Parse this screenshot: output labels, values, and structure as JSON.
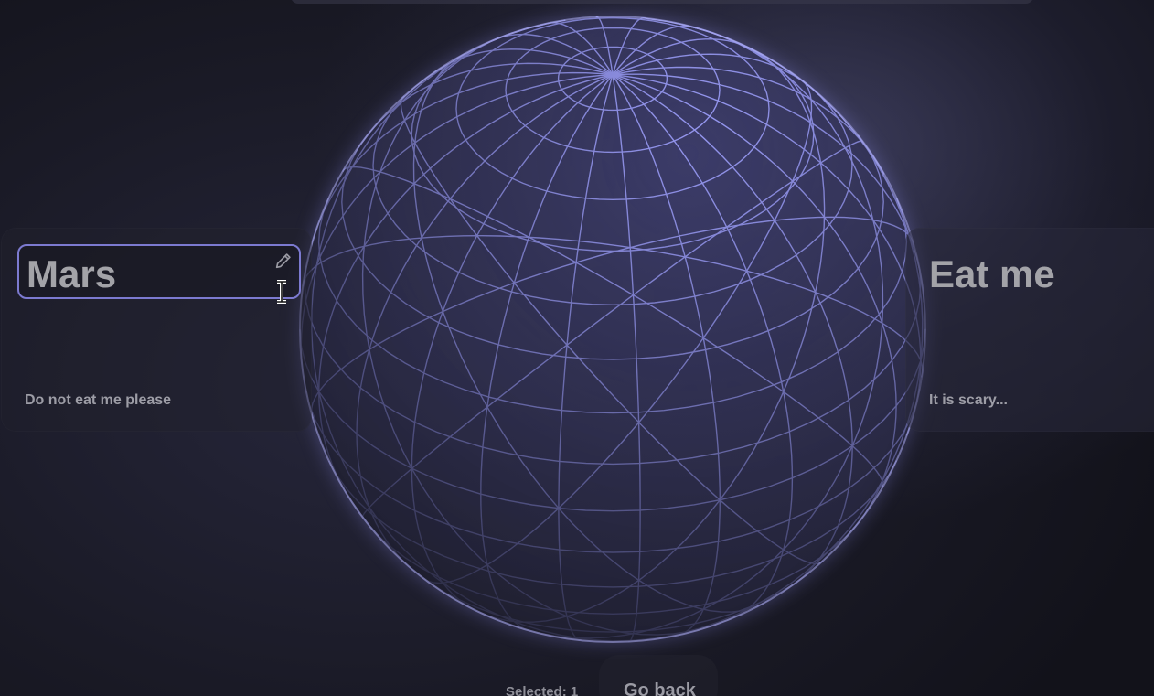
{
  "cards": [
    {
      "title": "Mars",
      "description": "Do not eat me please",
      "editing": true,
      "edit_icon": "pencil-icon"
    },
    {
      "title": "Eat me",
      "description": "It is scary..."
    }
  ],
  "footer": {
    "selected_label": "Selected: 1",
    "go_back_label": "Go back"
  },
  "globe": {
    "style": "wireframe-sphere",
    "color": "#9a9cff",
    "glow_color": "#c8c8ff"
  },
  "cursor": "text-cursor-icon",
  "colors": {
    "accent_border": "#7c7ad0",
    "text": "#a3a3a8"
  }
}
